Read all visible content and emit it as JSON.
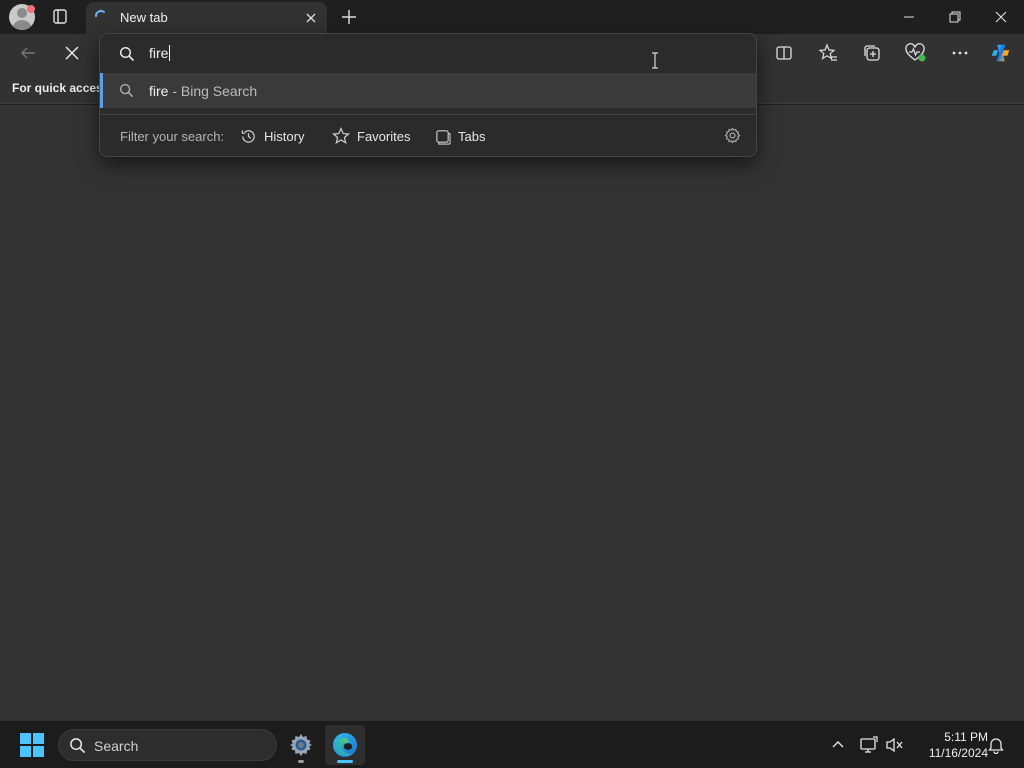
{
  "browser": {
    "tab": {
      "title": "New tab"
    },
    "favorites_bar": {
      "text": "For quick access"
    }
  },
  "omnibox": {
    "query": "fire",
    "suggestion": {
      "query": "fire",
      "suffix": " - Bing Search"
    },
    "filter": {
      "label": "Filter your search:",
      "options": [
        "History",
        "Favorites",
        "Tabs"
      ]
    }
  },
  "taskbar": {
    "search_placeholder": "Search",
    "time": "5:11 PM",
    "date": "11/16/2024"
  },
  "colors": {
    "accent": "#5ca0e0",
    "windows_blue": "#4cc2ff",
    "profile_badge": "#f1707b"
  },
  "icons": [
    "profile-avatar-icon",
    "tab-actions-icon",
    "loading-spinner-icon",
    "close-icon",
    "plus-icon",
    "minimize-icon",
    "restore-icon",
    "back-arrow-icon",
    "stop-icon",
    "split-screen-icon",
    "favorites-icon",
    "collections-icon",
    "browser-essentials-icon",
    "more-icon",
    "copilot-icon",
    "search-icon",
    "history-icon",
    "star-icon",
    "tabs-icon",
    "gear-icon",
    "windows-logo-icon",
    "settings-app-icon",
    "edge-icon",
    "chevron-up-icon",
    "display-icon",
    "speaker-muted-icon",
    "bell-icon"
  ]
}
